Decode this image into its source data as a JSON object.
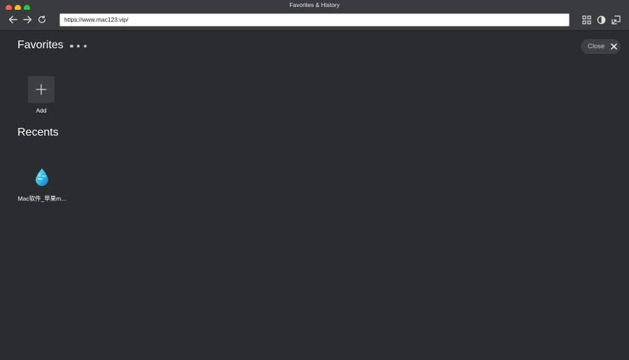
{
  "window": {
    "title": "Favorites & History"
  },
  "toolbar": {
    "url": "https://www.mac123.vip/"
  },
  "favorites": {
    "title": "Favorites",
    "add_label": "Add"
  },
  "recents": {
    "title": "Recents",
    "items": [
      {
        "label": "Mac软件_苹果m...",
        "icon": "water-drop-icon"
      }
    ]
  },
  "close_button": {
    "label": "Close"
  },
  "colors": {
    "background": "#2b2c2e",
    "toolbar": "#3a3b3d",
    "tile": "#3d3e41",
    "close_red": "#fe5f57",
    "minimize_yellow": "#febc2e",
    "maximize_green": "#28c840"
  }
}
